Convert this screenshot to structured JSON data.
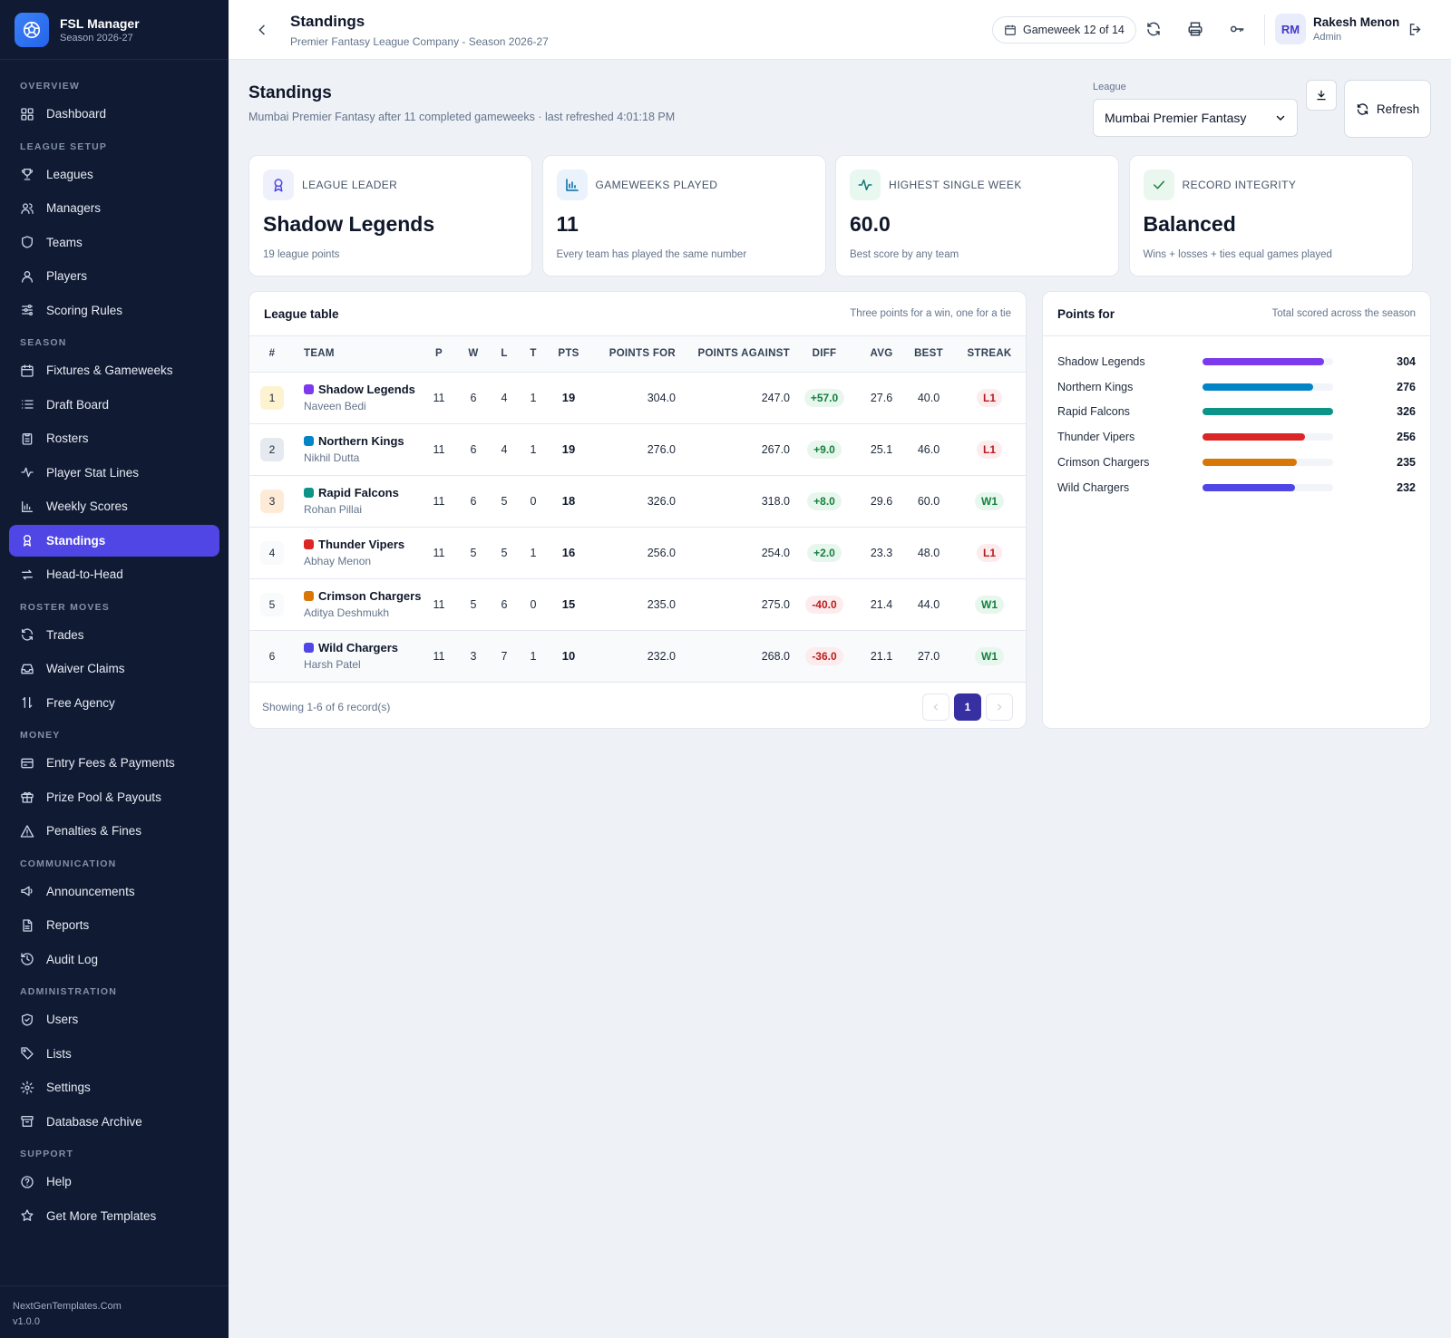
{
  "app": {
    "name": "FSL Manager",
    "season": "Season 2026-27"
  },
  "sidebar": {
    "sections": [
      {
        "title": "OVERVIEW",
        "items": [
          {
            "label": "Dashboard",
            "icon": "dashboard-icon"
          }
        ]
      },
      {
        "title": "LEAGUE SETUP",
        "items": [
          {
            "label": "Leagues",
            "icon": "trophy-icon"
          },
          {
            "label": "Managers",
            "icon": "users-icon"
          },
          {
            "label": "Teams",
            "icon": "shield-icon"
          },
          {
            "label": "Players",
            "icon": "user-icon"
          },
          {
            "label": "Scoring Rules",
            "icon": "sliders-icon"
          }
        ]
      },
      {
        "title": "SEASON",
        "items": [
          {
            "label": "Fixtures & Gameweeks",
            "icon": "calendar-icon"
          },
          {
            "label": "Draft Board",
            "icon": "list-icon"
          },
          {
            "label": "Rosters",
            "icon": "clipboard-icon"
          },
          {
            "label": "Player Stat Lines",
            "icon": "activity-icon"
          },
          {
            "label": "Weekly Scores",
            "icon": "bar-chart-icon"
          },
          {
            "label": "Standings",
            "icon": "award-icon",
            "active": true
          },
          {
            "label": "Head-to-Head",
            "icon": "swap-icon"
          }
        ]
      },
      {
        "title": "ROSTER MOVES",
        "items": [
          {
            "label": "Trades",
            "icon": "refresh-icon"
          },
          {
            "label": "Waiver Claims",
            "icon": "inbox-icon"
          },
          {
            "label": "Free Agency",
            "icon": "arrows-updown-icon"
          }
        ]
      },
      {
        "title": "MONEY",
        "items": [
          {
            "label": "Entry Fees & Payments",
            "icon": "credit-card-icon"
          },
          {
            "label": "Prize Pool & Payouts",
            "icon": "gift-icon"
          },
          {
            "label": "Penalties & Fines",
            "icon": "alert-triangle-icon"
          }
        ]
      },
      {
        "title": "COMMUNICATION",
        "items": [
          {
            "label": "Announcements",
            "icon": "megaphone-icon"
          },
          {
            "label": "Reports",
            "icon": "file-text-icon"
          },
          {
            "label": "Audit Log",
            "icon": "history-icon"
          }
        ]
      },
      {
        "title": "ADMINISTRATION",
        "items": [
          {
            "label": "Users",
            "icon": "shield-check-icon"
          },
          {
            "label": "Lists",
            "icon": "tag-icon"
          },
          {
            "label": "Settings",
            "icon": "gear-icon"
          },
          {
            "label": "Database Archive",
            "icon": "archive-icon"
          }
        ]
      },
      {
        "title": "SUPPORT",
        "items": [
          {
            "label": "Help",
            "icon": "help-circle-icon"
          },
          {
            "label": "Get More Templates",
            "icon": "star-icon"
          }
        ]
      }
    ],
    "footer": {
      "site": "NextGenTemplates.Com",
      "version": "v1.0.0"
    }
  },
  "topbar": {
    "title": "Standings",
    "subtitle": "Premier Fantasy League Company - Season 2026-27",
    "gameweek": "Gameweek 12 of 14",
    "user": {
      "initials": "RM",
      "name": "Rakesh Menon",
      "role": "Admin"
    }
  },
  "page": {
    "title": "Standings",
    "subtitle": "Mumbai Premier Fantasy after 11 completed gameweeks · last refreshed 4:01:18 PM",
    "league_label": "League",
    "league_selected": "Mumbai Premier Fantasy",
    "refresh_label": "Refresh"
  },
  "kpis": [
    {
      "label": "LEAGUE LEADER",
      "value": "Shadow Legends",
      "note": "19 league points",
      "icon": "award-icon",
      "bg": "#eef0fb",
      "fg": "#4f46e5"
    },
    {
      "label": "GAMEWEEKS PLAYED",
      "value": "11",
      "note": "Every team has played the same number",
      "icon": "bar-chart-icon",
      "bg": "#eaf3fb",
      "fg": "#0369a1"
    },
    {
      "label": "HIGHEST SINGLE WEEK",
      "value": "60.0",
      "note": "Best score by any team",
      "icon": "activity-icon",
      "bg": "#e9f7f1",
      "fg": "#0f766e"
    },
    {
      "label": "RECORD INTEGRITY",
      "value": "Balanced",
      "note": "Wins + losses + ties equal games played",
      "icon": "check-icon",
      "bg": "#e9f7ee",
      "fg": "#15803d"
    }
  ],
  "league_table": {
    "title": "League table",
    "note": "Three points for a win, one for a tie",
    "columns": [
      "#",
      "TEAM",
      "P",
      "W",
      "L",
      "T",
      "PTS",
      "POINTS FOR",
      "POINTS AGAINST",
      "DIFF",
      "AVG",
      "BEST",
      "STREAK"
    ],
    "rows": [
      {
        "rank": "1",
        "rank_bg": "#fdf3d0",
        "team": "Shadow Legends",
        "color": "#7c3aed",
        "manager": "Naveen Bedi",
        "p": "11",
        "w": "6",
        "l": "4",
        "t": "1",
        "pts": "19",
        "pf": "304.0",
        "pa": "247.0",
        "diff": "+57.0",
        "avg": "27.6",
        "best": "40.0",
        "streak": "L1"
      },
      {
        "rank": "2",
        "rank_bg": "#e5e9f0",
        "team": "Northern Kings",
        "color": "#0284c7",
        "manager": "Nikhil Dutta",
        "p": "11",
        "w": "6",
        "l": "4",
        "t": "1",
        "pts": "19",
        "pf": "276.0",
        "pa": "267.0",
        "diff": "+9.0",
        "avg": "25.1",
        "best": "46.0",
        "streak": "L1"
      },
      {
        "rank": "3",
        "rank_bg": "#fdebd8",
        "team": "Rapid Falcons",
        "color": "#0d9488",
        "manager": "Rohan Pillai",
        "p": "11",
        "w": "6",
        "l": "5",
        "t": "0",
        "pts": "18",
        "pf": "326.0",
        "pa": "318.0",
        "diff": "+8.0",
        "avg": "29.6",
        "best": "60.0",
        "streak": "W1"
      },
      {
        "rank": "4",
        "rank_bg": "#f8fafc",
        "team": "Thunder Vipers",
        "color": "#dc2626",
        "manager": "Abhay Menon",
        "p": "11",
        "w": "5",
        "l": "5",
        "t": "1",
        "pts": "16",
        "pf": "256.0",
        "pa": "254.0",
        "diff": "+2.0",
        "avg": "23.3",
        "best": "48.0",
        "streak": "L1"
      },
      {
        "rank": "5",
        "rank_bg": "#f8fafc",
        "team": "Crimson Chargers",
        "color": "#d97706",
        "manager": "Aditya Deshmukh",
        "p": "11",
        "w": "5",
        "l": "6",
        "t": "0",
        "pts": "15",
        "pf": "235.0",
        "pa": "275.0",
        "diff": "-40.0",
        "avg": "21.4",
        "best": "44.0",
        "streak": "W1"
      },
      {
        "rank": "6",
        "rank_bg": "#f8fafc",
        "team": "Wild Chargers",
        "color": "#4f46e5",
        "manager": "Harsh Patel",
        "p": "11",
        "w": "3",
        "l": "7",
        "t": "1",
        "pts": "10",
        "pf": "232.0",
        "pa": "268.0",
        "diff": "-36.0",
        "avg": "21.1",
        "best": "27.0",
        "streak": "W1"
      }
    ],
    "showing": "Showing 1-6 of 6 record(s)",
    "current_page": "1"
  },
  "chart_data": {
    "type": "bar",
    "title": "Points for",
    "subtitle": "Total scored across the season",
    "categories": [
      "Shadow Legends",
      "Northern Kings",
      "Rapid Falcons",
      "Thunder Vipers",
      "Crimson Chargers",
      "Wild Chargers"
    ],
    "values": [
      304,
      276,
      326,
      256,
      235,
      232
    ],
    "colors": [
      "#7c3aed",
      "#0284c7",
      "#0d9488",
      "#dc2626",
      "#d97706",
      "#4f46e5"
    ],
    "xlim": [
      0,
      326
    ],
    "orientation": "horizontal"
  }
}
